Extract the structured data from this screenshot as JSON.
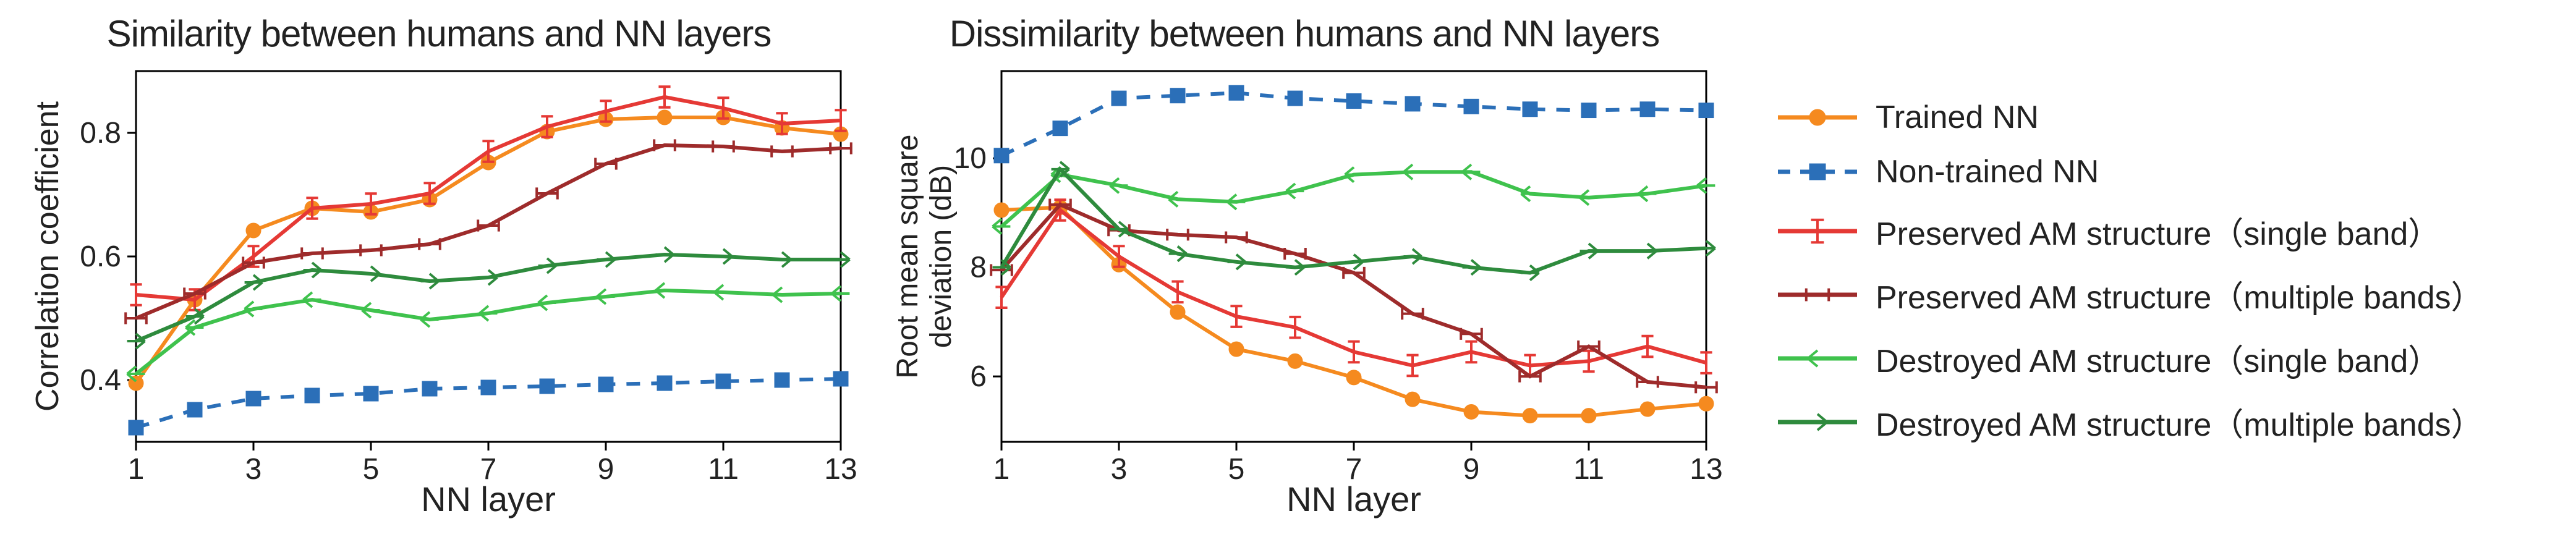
{
  "chart_data": [
    {
      "type": "line",
      "title": "Similarity between humans and NN layers",
      "xlabel": "NN layer",
      "ylabel": "Correlation coefficient",
      "x_ticks": [
        1,
        3,
        5,
        7,
        9,
        11,
        13
      ],
      "y_ticks": [
        0.4,
        0.6,
        0.8
      ],
      "xlim": [
        1,
        13
      ],
      "ylim": [
        0.3,
        0.9
      ],
      "x": [
        1,
        2,
        3,
        4,
        5,
        6,
        7,
        8,
        9,
        10,
        11,
        12,
        13
      ],
      "series": [
        {
          "name": "Trained NN",
          "color": "#f58a1f",
          "marker": "circle",
          "dash": false,
          "values": [
            0.395,
            0.53,
            0.642,
            0.678,
            0.672,
            0.692,
            0.752,
            0.802,
            0.822,
            0.825,
            0.825,
            0.808,
            0.798
          ]
        },
        {
          "name": "Non-trained NN",
          "color": "#2b6fb8",
          "marker": "square",
          "dash": true,
          "values": [
            0.323,
            0.352,
            0.37,
            0.375,
            0.378,
            0.386,
            0.388,
            0.39,
            0.393,
            0.395,
            0.398,
            0.4,
            0.402
          ]
        },
        {
          "name": "Preserved AM structure (single band)",
          "color": "#e53935",
          "marker": "xtick",
          "dash": false,
          "values": [
            0.538,
            0.53,
            0.6,
            0.678,
            0.685,
            0.702,
            0.77,
            0.81,
            0.835,
            0.858,
            0.84,
            0.815,
            0.82
          ]
        },
        {
          "name": "Preserved AM structure (multiple bands)",
          "color": "#9e2b2b",
          "marker": "ytick",
          "dash": false,
          "values": [
            0.5,
            0.54,
            0.59,
            0.605,
            0.61,
            0.62,
            0.65,
            0.702,
            0.75,
            0.78,
            0.778,
            0.77,
            0.775
          ]
        },
        {
          "name": "Destroyed AM structure (single band)",
          "color": "#3fc24d",
          "marker": "left",
          "dash": false,
          "values": [
            0.41,
            0.485,
            0.515,
            0.53,
            0.513,
            0.498,
            0.508,
            0.525,
            0.535,
            0.545,
            0.542,
            0.538,
            0.54
          ]
        },
        {
          "name": "Destroyed AM structure (multiple bands)",
          "color": "#2e8b3d",
          "marker": "right",
          "dash": false,
          "values": [
            0.463,
            0.503,
            0.558,
            0.578,
            0.572,
            0.56,
            0.566,
            0.585,
            0.595,
            0.603,
            0.6,
            0.595,
            0.595
          ]
        }
      ]
    },
    {
      "type": "line",
      "title": "Dissimilarity between humans and NN layers",
      "xlabel": "NN layer",
      "ylabel": "Root mean square deviation (dB)",
      "x_ticks": [
        1,
        3,
        5,
        7,
        9,
        11,
        13
      ],
      "y_ticks": [
        6,
        8,
        10
      ],
      "xlim": [
        1,
        13
      ],
      "ylim": [
        4.8,
        11.6
      ],
      "x": [
        1,
        2,
        3,
        4,
        5,
        6,
        7,
        8,
        9,
        10,
        11,
        12,
        13
      ],
      "series": [
        {
          "name": "Trained NN",
          "color": "#f58a1f",
          "marker": "circle",
          "dash": false,
          "values": [
            9.05,
            9.1,
            8.05,
            7.18,
            6.5,
            6.28,
            5.98,
            5.58,
            5.35,
            5.28,
            5.28,
            5.4,
            5.5
          ]
        },
        {
          "name": "Non-trained NN",
          "color": "#2b6fb8",
          "marker": "square",
          "dash": true,
          "values": [
            10.05,
            10.55,
            11.1,
            11.15,
            11.2,
            11.1,
            11.05,
            11.0,
            10.95,
            10.9,
            10.88,
            10.9,
            10.88
          ]
        },
        {
          "name": "Preserved AM structure (single band)",
          "color": "#e53935",
          "marker": "xtick",
          "dash": false,
          "values": [
            7.45,
            9.05,
            8.2,
            7.55,
            7.1,
            6.9,
            6.45,
            6.2,
            6.45,
            6.2,
            6.28,
            6.55,
            6.25
          ]
        },
        {
          "name": "Preserved AM structure (multiple bands)",
          "color": "#9e2b2b",
          "marker": "ytick",
          "dash": false,
          "values": [
            7.95,
            9.15,
            8.68,
            8.6,
            8.55,
            8.25,
            7.9,
            7.15,
            6.78,
            6.0,
            6.55,
            5.9,
            5.8
          ]
        },
        {
          "name": "Destroyed AM structure (single band)",
          "color": "#3fc24d",
          "marker": "left",
          "dash": false,
          "values": [
            8.75,
            9.7,
            9.5,
            9.25,
            9.2,
            9.4,
            9.7,
            9.75,
            9.75,
            9.35,
            9.28,
            9.35,
            9.5
          ]
        },
        {
          "name": "Destroyed AM structure (multiple bands)",
          "color": "#2e8b3d",
          "marker": "right",
          "dash": false,
          "values": [
            8.0,
            9.8,
            8.7,
            8.25,
            8.1,
            8.0,
            8.1,
            8.2,
            8.0,
            7.9,
            8.3,
            8.3,
            8.35
          ]
        }
      ]
    }
  ],
  "legend": {
    "items": [
      {
        "label": "Trained NN",
        "color": "#f58a1f",
        "marker": "circle",
        "dash": false
      },
      {
        "label": "Non-trained NN",
        "color": "#2b6fb8",
        "marker": "square",
        "dash": true
      },
      {
        "label": "Preserved AM structure（single band）",
        "color": "#e53935",
        "marker": "xtick",
        "dash": false
      },
      {
        "label": "Preserved AM structure（multiple bands）",
        "color": "#9e2b2b",
        "marker": "ytick",
        "dash": false
      },
      {
        "label": "Destroyed AM structure（single band）",
        "color": "#3fc24d",
        "marker": "left",
        "dash": false
      },
      {
        "label": "Destroyed AM structure（multiple bands）",
        "color": "#2e8b3d",
        "marker": "right",
        "dash": false
      }
    ]
  }
}
